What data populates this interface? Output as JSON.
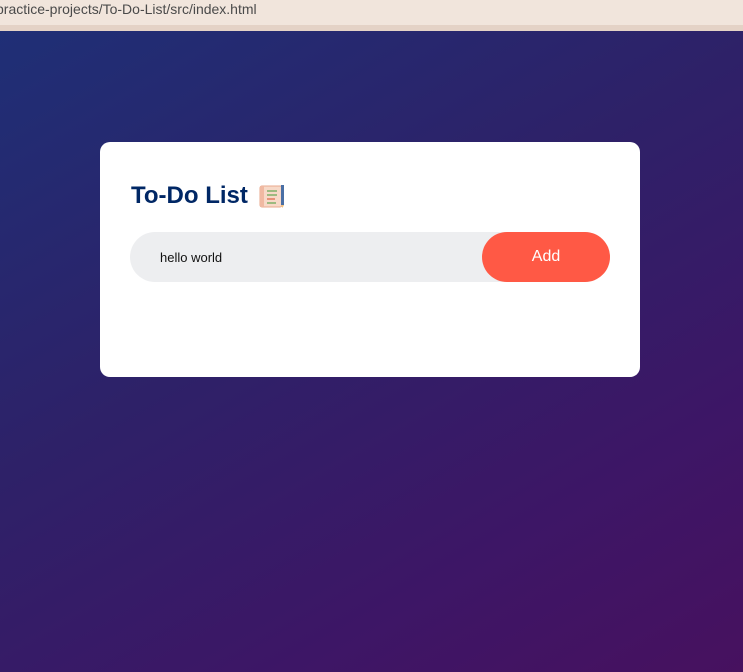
{
  "browser": {
    "address": "practice-projects/To-Do-List/src/index.html"
  },
  "app": {
    "title": "To-Do List",
    "title_icon": "notebook-icon",
    "input_value": "hello world",
    "add_label": "Add"
  },
  "colors": {
    "title": "#002765",
    "button": "#ff5945",
    "input_bg": "#edeef0",
    "card_bg": "#ffffff",
    "bg_start": "#1f2f76",
    "bg_end": "#47115f"
  }
}
